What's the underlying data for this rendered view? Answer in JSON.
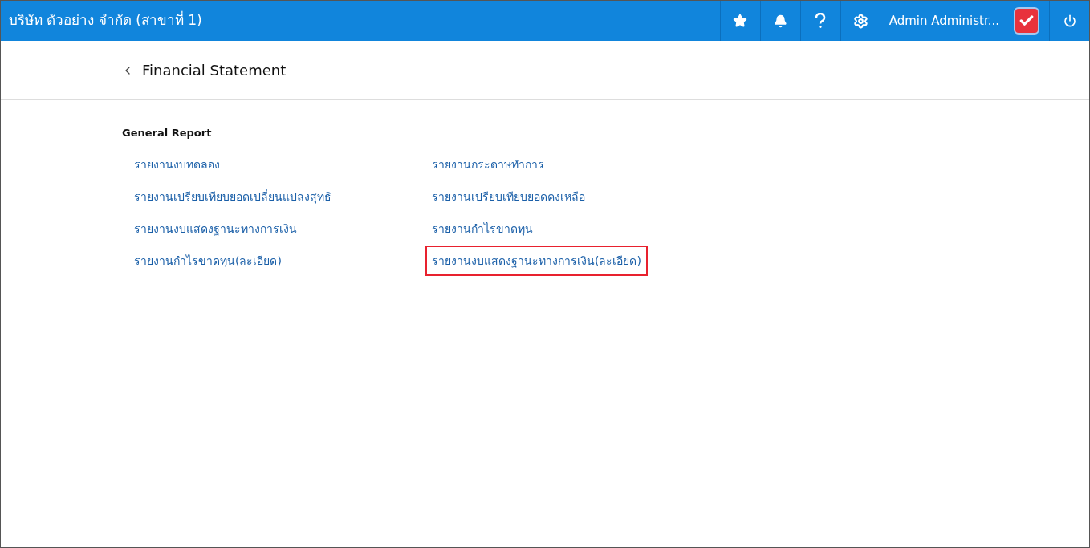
{
  "header": {
    "company": "บริษัท ตัวอย่าง จำกัด (สาขาที่ 1)",
    "user": "Admin Administr..."
  },
  "page": {
    "title": "Financial Statement"
  },
  "section": {
    "title": "General Report",
    "reports": [
      {
        "label": "รายงานงบทดลอง",
        "highlighted": false
      },
      {
        "label": "รายงานกระดาษทำการ",
        "highlighted": false
      },
      {
        "label": "รายงานเปรียบเทียบยอดเปลี่ยนแปลงสุทธิ",
        "highlighted": false
      },
      {
        "label": "รายงานเปรียบเทียบยอดคงเหลือ",
        "highlighted": false
      },
      {
        "label": "รายงานงบแสดงฐานะทางการเงิน",
        "highlighted": false
      },
      {
        "label": "รายงานกำไรขาดทุน",
        "highlighted": false
      },
      {
        "label": "รายงานกำไรขาดทุน(ละเอียด)",
        "highlighted": false
      },
      {
        "label": "รายงานงบแสดงฐานะทางการเงิน(ละเอียด)",
        "highlighted": true
      }
    ]
  }
}
